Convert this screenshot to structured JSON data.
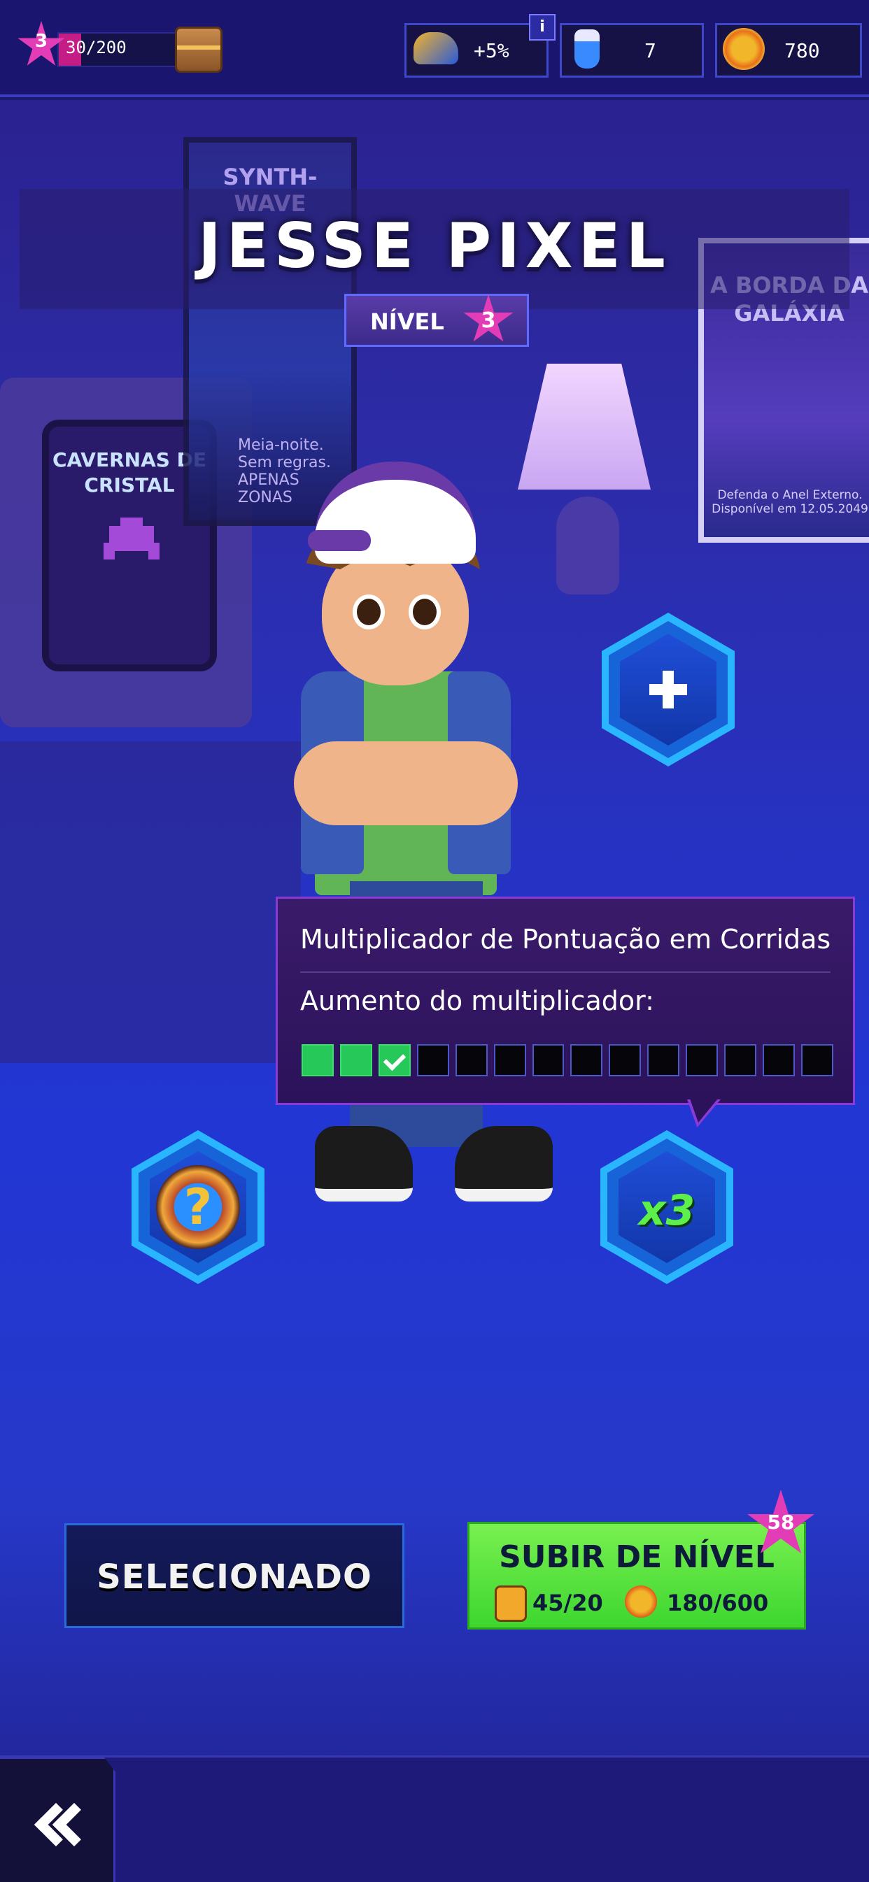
{
  "topbar": {
    "player_level": "3",
    "xp_progress": "30/200",
    "xp_fraction": 0.15,
    "boost": "+5%",
    "info_label": "i",
    "potions": "7",
    "coins": "780"
  },
  "character": {
    "name": "JESSE PIXEL",
    "level_label": "NÍVEL",
    "level": "3"
  },
  "decor": {
    "poster_left_title": "SYNTH-WAVE",
    "poster_left_text": "Meia-noite. Sem regras. APENAS ZONAS",
    "poster_right_title": "A BORDA DA GALÁXIA",
    "poster_right_text": "Defenda o Anel Externo. Disponível em 12.05.2049",
    "tv_text": "CAVERNAS DE CRISTAL"
  },
  "tooltip": {
    "title": "Multiplicador de Pontuação em Corridas",
    "subtitle": "Aumento do multiplicador:",
    "filled_segments": 3,
    "total_segments": 14
  },
  "skills": {
    "x3_label": "x3"
  },
  "buttons": {
    "selected_label": "SELECIONADO",
    "level_up_label": "SUBIR DE NÍVEL",
    "cards_cost": "45/20",
    "coins_cost": "180/600",
    "level_up_badge": "58"
  },
  "colors": {
    "accent_pink": "#e23cb7",
    "level_up_green": "#5df04a",
    "tooltip_border": "#8a3ad8"
  },
  "icons": {
    "boost": "shoe-icon",
    "potion": "potion-icon",
    "coin": "coin-icon",
    "chest": "chest-icon",
    "back": "double-chevron-left-icon"
  }
}
